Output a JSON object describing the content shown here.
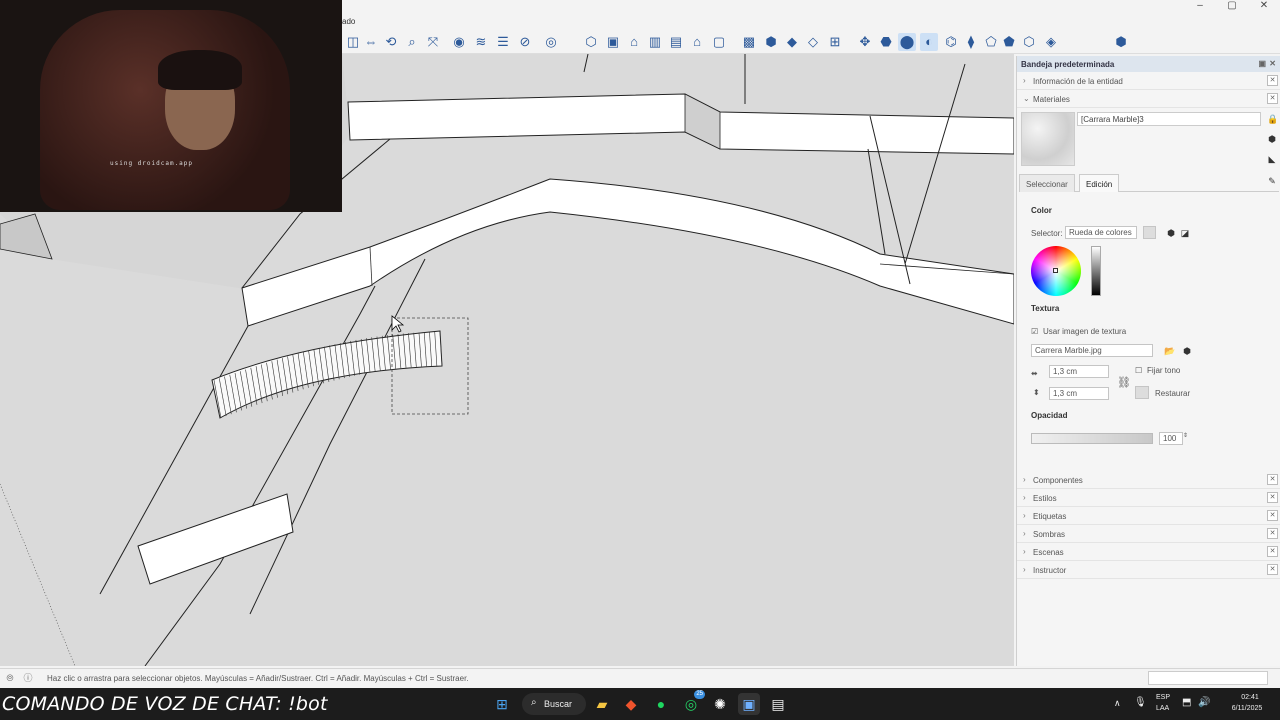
{
  "titlebar": {
    "menu_fragment": "ado"
  },
  "window_controls": [
    "–",
    "▢",
    "✕"
  ],
  "toolbar_icons": [
    {
      "name": "section-plane-icon",
      "glyph": "◫"
    },
    {
      "name": "walk-icon",
      "glyph": "⇔"
    },
    {
      "name": "look-icon",
      "glyph": "⟲"
    },
    {
      "name": "zoom-icon",
      "glyph": "⌕"
    },
    {
      "name": "zoom-extents-icon",
      "glyph": "⤧"
    },
    {
      "name": "eye-icon",
      "glyph": "◉"
    },
    {
      "name": "layers-icon",
      "glyph": "≋"
    },
    {
      "name": "styles-icon",
      "glyph": "☰"
    },
    {
      "name": "xray-icon",
      "glyph": "⊘"
    },
    {
      "name": "camera-icon",
      "glyph": "◎"
    },
    {
      "name": "iso-view-icon",
      "glyph": "⬡"
    },
    {
      "name": "top-view-icon",
      "glyph": "▣"
    },
    {
      "name": "front-view-icon",
      "glyph": "⌂"
    },
    {
      "name": "right-view-icon",
      "glyph": "▥"
    },
    {
      "name": "back-view-icon",
      "glyph": "▤"
    },
    {
      "name": "left-view-icon",
      "glyph": "⌂"
    },
    {
      "name": "bottom-view-icon",
      "glyph": "▢"
    },
    {
      "name": "box-icon",
      "glyph": "▩"
    },
    {
      "name": "wireframe-icon",
      "glyph": "⬢"
    },
    {
      "name": "paint-bucket-icon",
      "glyph": "◆"
    },
    {
      "name": "hidden-line-icon",
      "glyph": "◇"
    },
    {
      "name": "shaded-icon",
      "glyph": "⊞"
    },
    {
      "name": "axes-icon",
      "glyph": "✥"
    },
    {
      "name": "group-icon",
      "glyph": "⬣"
    },
    {
      "name": "component-icon",
      "glyph": "⬤"
    },
    {
      "name": "shadow-icon",
      "glyph": "◐"
    },
    {
      "name": "sandbox-icon",
      "glyph": "⌬"
    },
    {
      "name": "smoove-icon",
      "glyph": "⧫"
    },
    {
      "name": "stamp-icon",
      "glyph": "⬠"
    },
    {
      "name": "drape-icon",
      "glyph": "⬟"
    },
    {
      "name": "add-detail-icon",
      "glyph": "⬡"
    },
    {
      "name": "flip-edge-icon",
      "glyph": "◈"
    },
    {
      "name": "extension-icon",
      "glyph": "⬢"
    }
  ],
  "tray": {
    "title": "Bandeja predeterminada",
    "entity_info": "Información de la entidad",
    "materials": "Materiales",
    "material_name": "[Carrara Marble]3",
    "tabs": [
      "Seleccionar",
      "Edición"
    ],
    "color_label": "Color",
    "selector_label": "Selector:",
    "selector_value": "Rueda de colores",
    "texture_label": "Textura",
    "use_texture_label": "Usar imagen de textura",
    "texture_file": "Carrera Marble.jpg",
    "width_value": "1,3 cm",
    "height_value": "1,3 cm",
    "fix_tone_label": "Fijar tono",
    "restore_label": "Restaurar",
    "opacity_label": "Opacidad",
    "opacity_value": "100",
    "collapsed_panels": [
      "Componentes",
      "Estilos",
      "Etiquetas",
      "Sombras",
      "Escenas",
      "Instructor"
    ]
  },
  "statusbar": {
    "hint": "Haz clic o arrastra para seleccionar objetos. Mayúsculas = Añadir/Sustraer. Ctrl = Añadir. Mayúsculas + Ctrl = Sustraer."
  },
  "webcam": {
    "caption": "using droidcam.app"
  },
  "overlay": {
    "command": "COMANDO DE VOZ DE CHAT: !bot"
  },
  "taskbar": {
    "search_label": "Buscar",
    "lang_top": "ESP",
    "lang_bottom": "LAA",
    "time": "02:41",
    "date": "6/11/2025",
    "whatsapp_badge": "25"
  }
}
